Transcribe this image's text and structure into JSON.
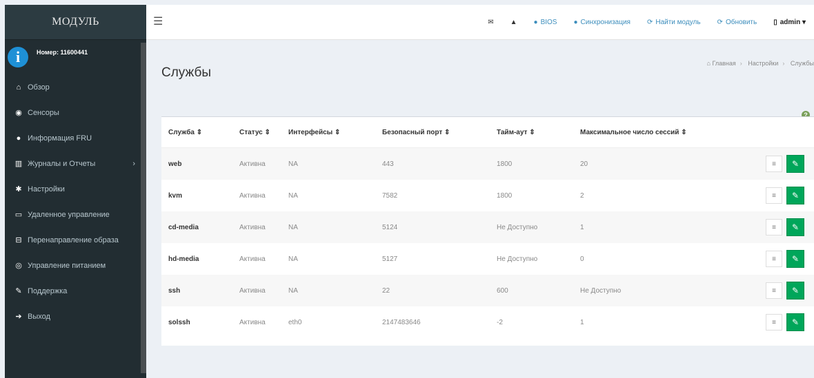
{
  "sidebar": {
    "logo": "МОДУЛЬ",
    "user_number": "Номер: 11600441",
    "items": [
      {
        "icon": "home-icon",
        "glyph": "⌂",
        "label": "Обзор"
      },
      {
        "icon": "dashboard-icon",
        "glyph": "◉",
        "label": "Сенсоры"
      },
      {
        "icon": "info-icon",
        "glyph": "●",
        "label": "Информация FRU"
      },
      {
        "icon": "bar-chart-icon",
        "glyph": "▥",
        "label": "Журналы и Отчеты",
        "arrow": "›"
      },
      {
        "icon": "gear-icon",
        "glyph": "✱",
        "label": "Настройки"
      },
      {
        "icon": "monitor-icon",
        "glyph": "▭",
        "label": "Удаленное управление"
      },
      {
        "icon": "redirect-icon",
        "glyph": "⊟",
        "label": "Перенаправление образа"
      },
      {
        "icon": "power-icon",
        "glyph": "◎",
        "label": "Управление питанием"
      },
      {
        "icon": "wrench-icon",
        "glyph": "✎",
        "label": "Поддержка"
      },
      {
        "icon": "logout-icon",
        "glyph": "➔",
        "label": "Выход"
      }
    ]
  },
  "header": {
    "bios": "BIOS",
    "sync": "Синхронизация",
    "find_module": "Найти модуль",
    "refresh": "Обновить",
    "user": "admin",
    "user_caret": "▾"
  },
  "page": {
    "title": "Службы",
    "breadcrumb": [
      "Главная",
      "Настройки",
      "Службы"
    ]
  },
  "table": {
    "columns": [
      "Служба ⇕",
      "Статус ⇕",
      "Интерфейсы ⇕",
      "Безопасный порт ⇕",
      "Тайм-аут ⇕",
      "Максимальное число сессий ⇕"
    ],
    "rows": [
      [
        "web",
        "Активна",
        "NA",
        "443",
        "1800",
        "20"
      ],
      [
        "kvm",
        "Активна",
        "NA",
        "7582",
        "1800",
        "2"
      ],
      [
        "cd-media",
        "Активна",
        "NA",
        "5124",
        "Не Доступно",
        "1"
      ],
      [
        "hd-media",
        "Активна",
        "NA",
        "5127",
        "Не Доступно",
        "0"
      ],
      [
        "ssh",
        "Активна",
        "NA",
        "22",
        "600",
        "Не Доступно"
      ],
      [
        "solssh",
        "Активна",
        "eth0",
        "2147483646",
        "-2",
        "1"
      ]
    ]
  },
  "colors": {
    "sidebar_bg": "#222d32",
    "accent": "#3c8dbc",
    "edit_button": "#00a65a"
  }
}
